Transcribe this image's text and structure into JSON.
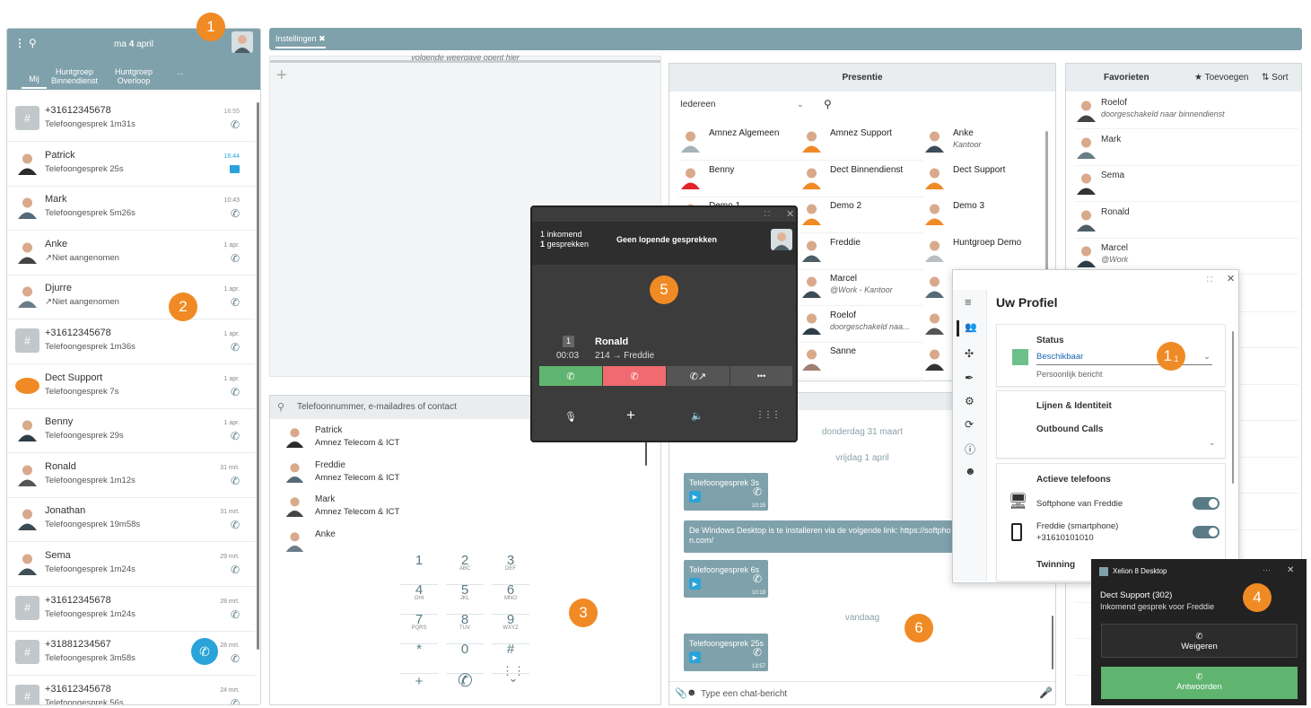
{
  "left": {
    "date_prefix": "ma",
    "date_day": "4",
    "date_month": "april",
    "tabs": [
      {
        "label": "Mij"
      },
      {
        "label": "Huntgroep Binnendienst"
      },
      {
        "label": "Huntgroep Overloop"
      },
      {
        "label": "..."
      }
    ],
    "calls": [
      {
        "name": "+31612345678",
        "sub": "Telefoongesprek  1m31s",
        "time": "16:55",
        "icon": "phone-icon",
        "type": "hash"
      },
      {
        "name": "Patrick",
        "sub": "Telefoongesprek  25s",
        "time": "16:44",
        "icon": "chat-icon",
        "type": "person"
      },
      {
        "name": "Mark",
        "sub": "Telefoongesprek  5m26s",
        "time": "10:43",
        "icon": "phone-icon",
        "type": "person"
      },
      {
        "name": "Anke",
        "sub": "↗Niet aangenomen",
        "time": "1 apr.",
        "icon": "phone-icon",
        "type": "person"
      },
      {
        "name": "Djurre",
        "sub": "↗Niet aangenomen",
        "time": "1 apr.",
        "icon": "phone-icon",
        "type": "person"
      },
      {
        "name": "+31612345678",
        "sub": "Telefoongesprek  1m36s",
        "time": "1 apr.",
        "icon": "phone-icon",
        "type": "hash"
      },
      {
        "name": "Dect Support",
        "sub": "Telefoongesprek  7s",
        "time": "1 apr.",
        "icon": "phone-icon",
        "type": "amnez"
      },
      {
        "name": "Benny",
        "sub": "Telefoongesprek  29s",
        "time": "1 apr.",
        "icon": "phone-icon",
        "type": "person"
      },
      {
        "name": "Ronald",
        "sub": "Telefoongesprek  1m12s",
        "time": "31 mrt.",
        "icon": "phone-icon",
        "type": "person"
      },
      {
        "name": "Jonathan",
        "sub": "Telefoongesprek  19m58s",
        "time": "31 mrt.",
        "icon": "phone-icon",
        "type": "person"
      },
      {
        "name": "Sema",
        "sub": "Telefoongesprek  1m24s",
        "time": "29 mrt.",
        "icon": "phone-icon",
        "type": "person"
      },
      {
        "name": "+31612345678",
        "sub": "Telefoongesprek  1m24s",
        "time": "28 mrt.",
        "icon": "phone-icon",
        "type": "hash"
      },
      {
        "name": "+31881234567",
        "sub": "Telefoongesprek  3m58s",
        "time": "28 mrt.",
        "icon": "phone-icon",
        "type": "hash"
      },
      {
        "name": "+31612345678",
        "sub": "Telefoongesprek  56s",
        "time": "24 mrt.",
        "icon": "phone-icon",
        "type": "hash"
      }
    ]
  },
  "topbar": {
    "tab_label": "Instellingen"
  },
  "empty_panel": {
    "hint": "volgende weergave opent hier",
    "add": "+"
  },
  "presence": {
    "title": "Presentie",
    "filter": "Iedereen",
    "items": [
      {
        "name": "Amnez Algemeen",
        "sub": ""
      },
      {
        "name": "Amnez Support",
        "sub": ""
      },
      {
        "name": "Anke",
        "sub": "Kantoor"
      },
      {
        "name": "Benny",
        "sub": ""
      },
      {
        "name": "Dect Binnendienst",
        "sub": ""
      },
      {
        "name": "Dect Support",
        "sub": ""
      },
      {
        "name": "Demo 1",
        "sub": ""
      },
      {
        "name": "Demo 2",
        "sub": ""
      },
      {
        "name": "Demo 3",
        "sub": ""
      },
      {
        "name": "",
        "sub": ""
      },
      {
        "name": "Freddie",
        "sub": ""
      },
      {
        "name": "Huntgroep Demo",
        "sub": ""
      },
      {
        "name": "",
        "sub": ""
      },
      {
        "name": "Marcel",
        "sub": "@Work - Kantoor"
      },
      {
        "name": "",
        "sub": ""
      },
      {
        "name": "",
        "sub": ""
      },
      {
        "name": "Roelof",
        "sub": "doorgeschakeld naa..."
      },
      {
        "name": "",
        "sub": ""
      },
      {
        "name": "",
        "sub": ""
      },
      {
        "name": "Sanne",
        "sub": ""
      },
      {
        "name": "",
        "sub": ""
      }
    ]
  },
  "favorites": {
    "title": "Favorieten",
    "add_label": "Toevoegen",
    "sort_label": "Sort",
    "items": [
      {
        "name": "Roelof",
        "sub": "doorgeschakeld naar binnendienst"
      },
      {
        "name": "Mark",
        "sub": ""
      },
      {
        "name": "Sema",
        "sub": ""
      },
      {
        "name": "Ronald",
        "sub": ""
      },
      {
        "name": "Marcel",
        "sub": "@Work"
      }
    ]
  },
  "dialer": {
    "search_placeholder": "Telefoonnummer, e-mailadres of contact",
    "contacts": [
      {
        "name": "Patrick",
        "company": "Amnez Telecom & ICT"
      },
      {
        "name": "Freddie",
        "company": "Amnez Telecom & ICT"
      },
      {
        "name": "Mark",
        "company": "Amnez Telecom & ICT"
      },
      {
        "name": "Anke",
        "company": ""
      }
    ],
    "keys": [
      {
        "d": "1",
        "l": ""
      },
      {
        "d": "2",
        "l": "ABC"
      },
      {
        "d": "3",
        "l": "DEF"
      },
      {
        "d": "4",
        "l": "GHI"
      },
      {
        "d": "5",
        "l": "JKL"
      },
      {
        "d": "6",
        "l": "MNO"
      },
      {
        "d": "7",
        "l": "PQRS"
      },
      {
        "d": "8",
        "l": "TUV"
      },
      {
        "d": "9",
        "l": "WXYZ"
      },
      {
        "d": "*",
        "l": ""
      },
      {
        "d": "0",
        "l": ""
      },
      {
        "d": "#",
        "l": ""
      }
    ],
    "plus": "+"
  },
  "call_window": {
    "incoming_line1": "1 inkomend",
    "incoming_line2_bold": "1",
    "incoming_line2": "gesprekken",
    "status": "Geen lopende gesprekken",
    "line_no": "1",
    "caller": "Ronald",
    "duration": "00:03",
    "route": "214 → Freddie",
    "more": "•••"
  },
  "chat": {
    "day1": "donderdag 31 maart",
    "day2": "vrijdag 1 april",
    "day3": "vandaag",
    "messages": [
      {
        "label": "Telefoongesprek  3s",
        "time": "10:15"
      },
      {
        "label": "De Windows Desktop is te installeren via de volgende link: https://softpho n.com/",
        "time": ""
      },
      {
        "label": "Telefoongesprek  6s",
        "time": "10:19"
      },
      {
        "label": "Telefoongesprek  25s",
        "time": "13:57"
      }
    ],
    "input_placeholder": "Type een chat-bericht"
  },
  "profile": {
    "title": "Uw Profiel",
    "status_label": "Status",
    "status_value": "Beschikbaar",
    "personal_msg": "Persoonlijk bericht",
    "lines_label": "Lijnen & Identiteit",
    "outbound_label": "Outbound Calls",
    "phones_label": "Actieve telefoons",
    "softphone": "Softphone van Freddie",
    "smartphone": "Freddie (smartphone)",
    "smartphone_number": "+31610101010",
    "twinning": "Twinning",
    "status_color": "#6cc08b"
  },
  "notification": {
    "app": "Xelion 8 Desktop",
    "title": "Dect Support (302)",
    "body": "Inkomend gesprek voor Freddie",
    "reject": "Weigeren",
    "accept": "Antwoorden",
    "more": "···",
    "accept_color": "#5fb56f"
  },
  "callouts": {
    "b1": "1",
    "b2": "2",
    "b3": "3",
    "b4": "4",
    "b5": "5",
    "b6": "6",
    "b11_main": "1",
    "b11_sub": ".1"
  },
  "colors": {
    "accent": "#7fa1ab",
    "orange": "#f08a24",
    "green": "#5fb56f",
    "red": "#ef6b6f",
    "blue": "#2aa3d8"
  }
}
